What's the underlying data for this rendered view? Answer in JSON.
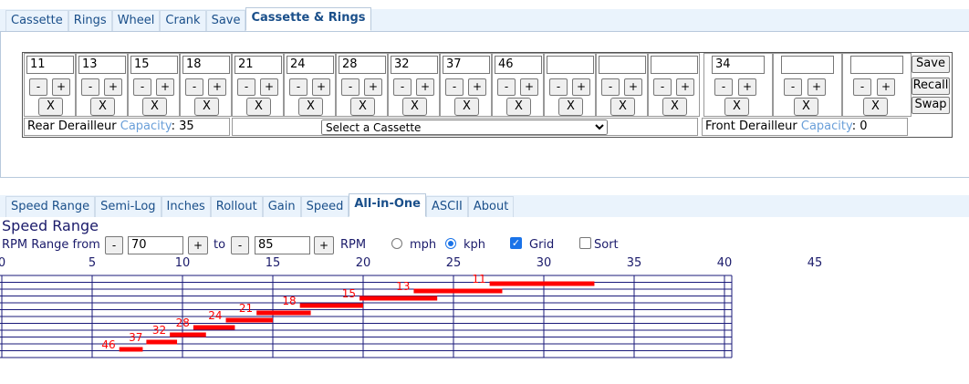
{
  "top_tabs": [
    "Cassette",
    "Rings",
    "Wheel",
    "Crank",
    "Save",
    "Cassette & Rings"
  ],
  "active_top_tab": 5,
  "cassette": {
    "cogs": [
      "11",
      "13",
      "15",
      "18",
      "21",
      "24",
      "28",
      "32",
      "37",
      "46",
      "",
      "",
      ""
    ],
    "minus": "-",
    "plus": "+",
    "remove": "X"
  },
  "rings": {
    "values": [
      "34",
      "",
      ""
    ]
  },
  "side_buttons": {
    "save": "Save",
    "recall": "Recall",
    "swap": "Swap"
  },
  "rear_derailleur": {
    "label": "Rear Derailleur",
    "link": "Capacity",
    "colon": ":",
    "value": "35"
  },
  "front_derailleur": {
    "label": "Front Derailleur",
    "link": "Capacity",
    "colon": ":",
    "value": "0"
  },
  "cassette_select": {
    "selected": "Select a Cassette"
  },
  "bottom_tabs": [
    "Speed Range",
    "Semi-Log",
    "Inches",
    "Rollout",
    "Gain",
    "Speed",
    "All-in-One",
    "ASCII",
    "About"
  ],
  "active_bottom_tab": 6,
  "section_title": "Speed Range",
  "rpm": {
    "label": "RPM Range from",
    "from": "70",
    "to_label": "to",
    "to": "85",
    "unit": "RPM",
    "minus": "-",
    "plus": "+"
  },
  "units": {
    "mph": "mph",
    "kph": "kph",
    "selected": "kph"
  },
  "options": {
    "grid": "Grid",
    "grid_checked": true,
    "sort": "Sort",
    "sort_checked": false
  },
  "colors": {
    "bar": "#ff0000",
    "grid": "#1a1a7a",
    "tab_text": "#1a4f8a",
    "link": "#6a9fd9"
  },
  "chart_data": {
    "type": "bar",
    "x_ticks": [
      0,
      5,
      10,
      15,
      20,
      25,
      30,
      35,
      40,
      45
    ],
    "xlim": [
      0,
      40
    ],
    "grid": true,
    "series": [
      {
        "name": "11",
        "range": [
          27.0,
          32.8
        ]
      },
      {
        "name": "13",
        "range": [
          22.8,
          27.7
        ]
      },
      {
        "name": "15",
        "range": [
          19.8,
          24.1
        ]
      },
      {
        "name": "18",
        "range": [
          16.5,
          20.0
        ]
      },
      {
        "name": "21",
        "range": [
          14.1,
          17.1
        ]
      },
      {
        "name": "24",
        "range": [
          12.4,
          15.0
        ]
      },
      {
        "name": "28",
        "range": [
          10.6,
          12.9
        ]
      },
      {
        "name": "32",
        "range": [
          9.3,
          11.3
        ]
      },
      {
        "name": "37",
        "range": [
          8.0,
          9.7
        ]
      },
      {
        "name": "46",
        "range": [
          6.5,
          7.8
        ]
      }
    ]
  }
}
